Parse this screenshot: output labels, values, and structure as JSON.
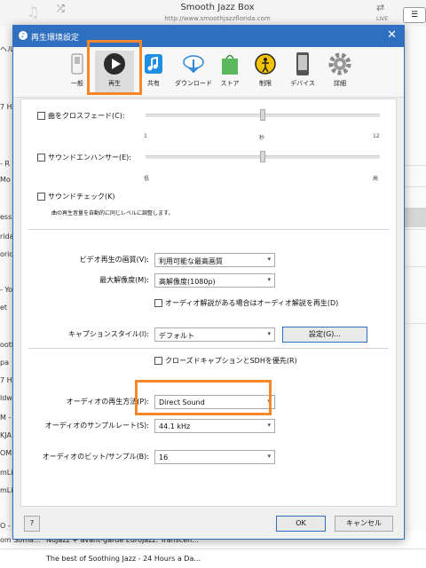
{
  "background": {
    "title": "Smooth Jazz Box",
    "url": "http://www.smoothjazzflorida.com",
    "live_label": "LIVE",
    "left_rows": [
      "ヘル",
      "7 HI",
      "- R",
      "Mo",
      "essi",
      "rida",
      "orida",
      "- Yo",
      "et",
      "ooth",
      "pa",
      "7 HI",
      "ldw",
      "M -",
      "KJA",
      "OM.",
      "mLi",
      "mLi",
      "O -",
      "om Soma..."
    ],
    "bottom_rows": [
      "NuJazz + avant-garde EuroJazz. Transcen...",
      "The best of Soothing Jazz - 24 Hours a Da..."
    ]
  },
  "dialog": {
    "title": "再生環境設定",
    "tabs": [
      {
        "label": "一般",
        "icon": "general-switch-icon"
      },
      {
        "label": "再生",
        "icon": "play-icon"
      },
      {
        "label": "共有",
        "icon": "music-share-icon"
      },
      {
        "label": "ダウンロード",
        "icon": "download-cloud-icon"
      },
      {
        "label": "ストア",
        "icon": "store-bag-icon"
      },
      {
        "label": "制限",
        "icon": "restrictions-icon"
      },
      {
        "label": "デバイス",
        "icon": "device-icon"
      },
      {
        "label": "詳細",
        "icon": "gear-icon"
      }
    ],
    "crossfade": {
      "label": "曲をクロスフェード(C):",
      "tick_min": "1",
      "tick_mid": "秒",
      "tick_max": "12",
      "value": 0.5
    },
    "enhancer": {
      "label": "サウンドエンハンサー(E):",
      "tick_min": "低",
      "tick_max": "高",
      "value": 0.5
    },
    "soundcheck": {
      "label": "サウンドチェック(K)",
      "description": "曲の再生音量を自動的に同じレベルに調整します。"
    },
    "video_quality": {
      "label": "ビデオ再生の画質(V):",
      "value": "利用可能な最高画質"
    },
    "max_resolution": {
      "label": "最大解像度(M):",
      "value": "高解像度(1080p)"
    },
    "audio_description": {
      "label": "オーディオ解説がある場合はオーディオ解説を再生(D)"
    },
    "caption_style": {
      "label": "キャプションスタイル(I):",
      "value": "デフォルト",
      "button": "設定(G)..."
    },
    "closed_caption": {
      "label": "クローズドキャプションとSDHを優先(R)"
    },
    "audio_playback": {
      "label": "オーディオの再生方法(P):",
      "value": "Direct Sound"
    },
    "sample_rate": {
      "label": "オーディオのサンプルレート(S):",
      "value": "44.1 kHz"
    },
    "bits_per_sample": {
      "label": "オーディオのビット/サンプル(B):",
      "value": "16"
    },
    "help": "?",
    "ok": "OK",
    "cancel": "キャンセル"
  },
  "colors": {
    "titlebar": "#2f6fbf",
    "highlight": "#f5862a"
  }
}
